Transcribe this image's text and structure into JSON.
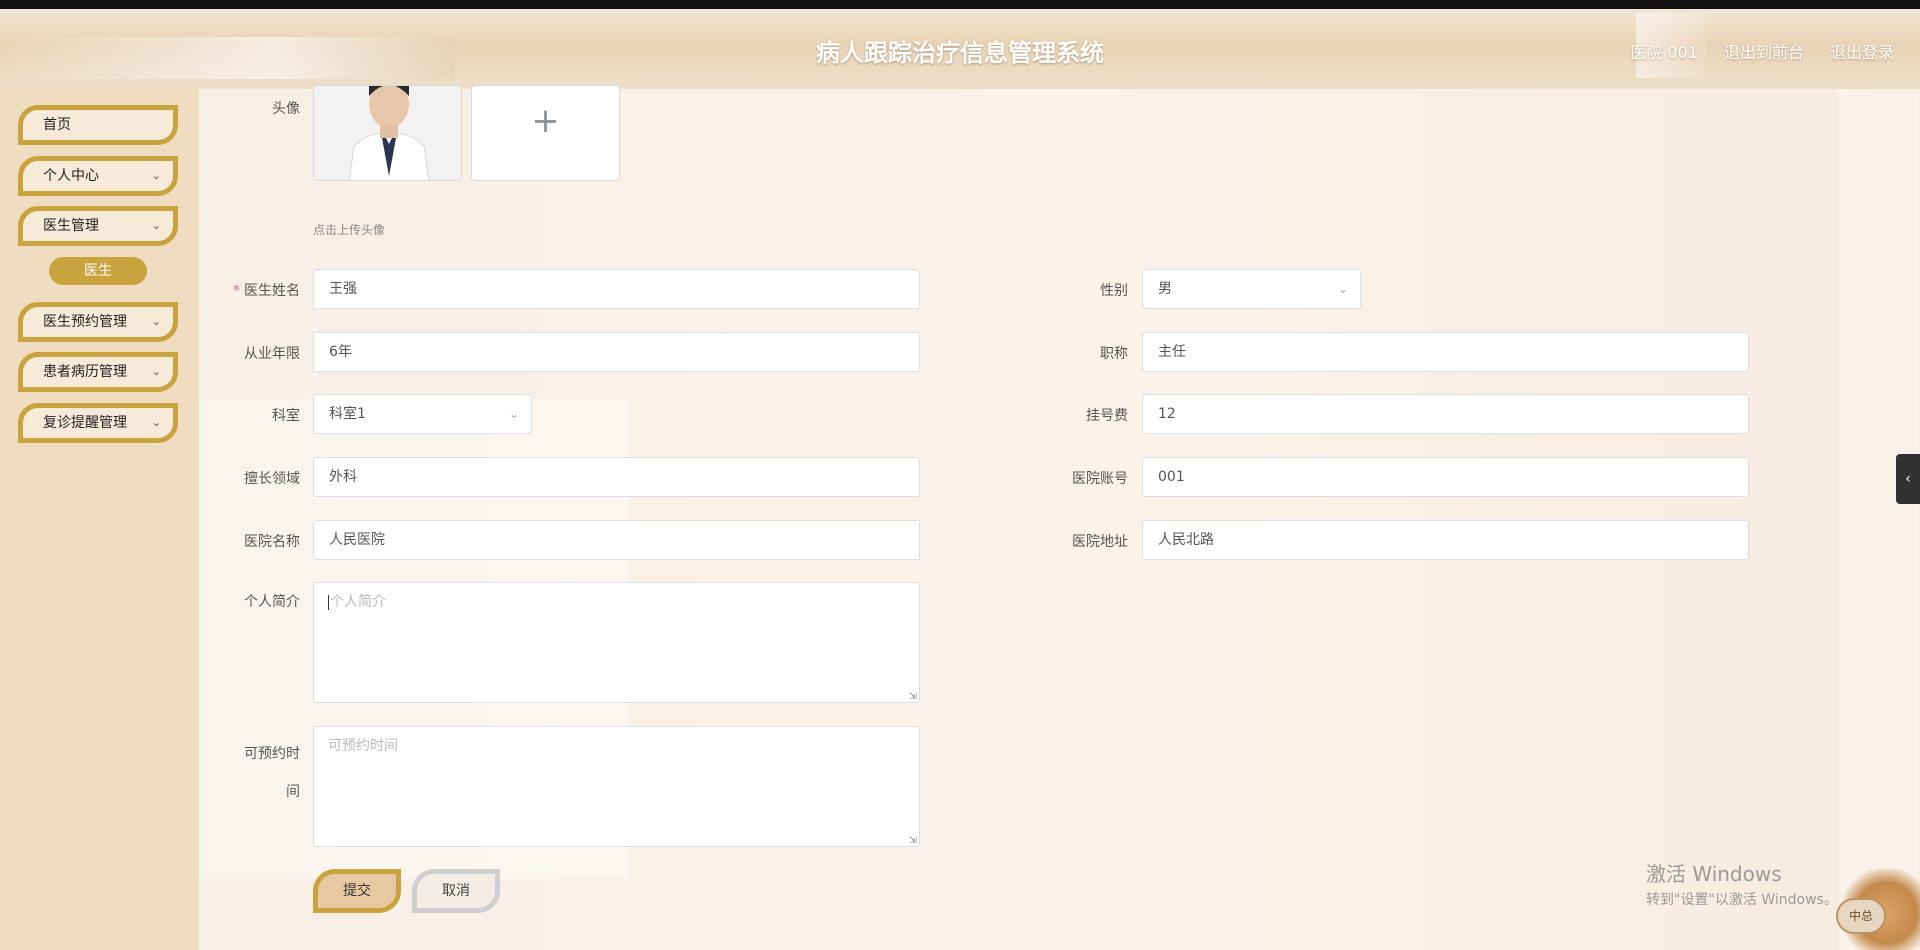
{
  "header": {
    "title": "病人跟踪治疗信息管理系统",
    "user": "医院 001",
    "to_front": "退出到前台",
    "logout": "退出登录"
  },
  "sidebar": {
    "items": [
      {
        "label": "首页",
        "has_children": false
      },
      {
        "label": "个人中心",
        "has_children": true
      },
      {
        "label": "医生管理",
        "has_children": true
      },
      {
        "label": "医生预约管理",
        "has_children": true
      },
      {
        "label": "患者病历管理",
        "has_children": true
      },
      {
        "label": "复诊提醒管理",
        "has_children": true
      }
    ],
    "active_sub": "医生"
  },
  "form": {
    "avatar_label": "头像",
    "upload_plus": "+",
    "upload_tip": "点击上传头像",
    "name_label": "医生姓名",
    "name_value": "王强",
    "gender_label": "性别",
    "gender_value": "男",
    "years_label": "从业年限",
    "years_value": "6年",
    "title_label": "职称",
    "title_value": "主任",
    "dept_label": "科室",
    "dept_value": "科室1",
    "fee_label": "挂号费",
    "fee_value": "12",
    "specialty_label": "擅长领域",
    "specialty_value": "外科",
    "account_label": "医院账号",
    "account_value": "001",
    "hospital_label": "医院名称",
    "hospital_value": "人民医院",
    "address_label": "医院地址",
    "address_value": "人民北路",
    "intro_label": "个人简介",
    "intro_placeholder": "个人简介",
    "time_label_1": "可预约时",
    "time_label_2": "间",
    "time_placeholder": "可预约时间",
    "submit": "提交",
    "cancel": "取消"
  },
  "watermark": {
    "line1": "激活 Windows",
    "line2": "转到\"设置\"以激活 Windows。"
  },
  "mascot_text": "中总",
  "colors": {
    "accent": "#c9a43e",
    "sidebar_bg": "#f0dcc0",
    "required": "#f56c6c"
  }
}
